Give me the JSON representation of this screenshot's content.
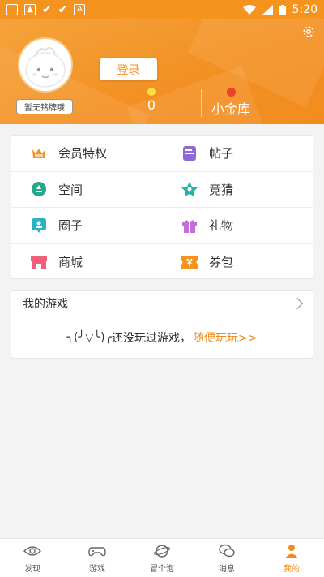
{
  "status_bar": {
    "time": "5:20"
  },
  "header": {
    "login_label": "登录",
    "badge_label": "暂无铭牌哦",
    "coins_value": "0",
    "vault_label": "小金库"
  },
  "menu": {
    "items": [
      {
        "label": "会员特权",
        "icon": "crown-icon",
        "color": "#f5931f"
      },
      {
        "label": "帖子",
        "icon": "post-icon",
        "color": "#8f6ad6"
      },
      {
        "label": "空间",
        "icon": "space-icon",
        "color": "#22a88a"
      },
      {
        "label": "竞猜",
        "icon": "star-icon",
        "color": "#21b3a6"
      },
      {
        "label": "圈子",
        "icon": "circle-icon",
        "color": "#27b2c6"
      },
      {
        "label": "礼物",
        "icon": "gift-icon",
        "color": "#c26fd8"
      },
      {
        "label": "商城",
        "icon": "shop-icon",
        "color": "#f0607d"
      },
      {
        "label": "券包",
        "icon": "coupon-icon",
        "color": "#f5931f"
      }
    ]
  },
  "games": {
    "title": "我的游戏",
    "empty_face": "╮(╯▽╰)╭",
    "empty_text": "还没玩过游戏，",
    "empty_link": "随便玩玩>>"
  },
  "bottom_nav": {
    "items": [
      {
        "label": "发现",
        "icon": "eye-icon"
      },
      {
        "label": "游戏",
        "icon": "gamepad-icon"
      },
      {
        "label": "冒个泡",
        "icon": "bubble-icon"
      },
      {
        "label": "消息",
        "icon": "chat-icon"
      },
      {
        "label": "我的",
        "icon": "person-icon"
      }
    ]
  },
  "colors": {
    "brand": "#f39124",
    "accent_text": "#f08c1b"
  }
}
